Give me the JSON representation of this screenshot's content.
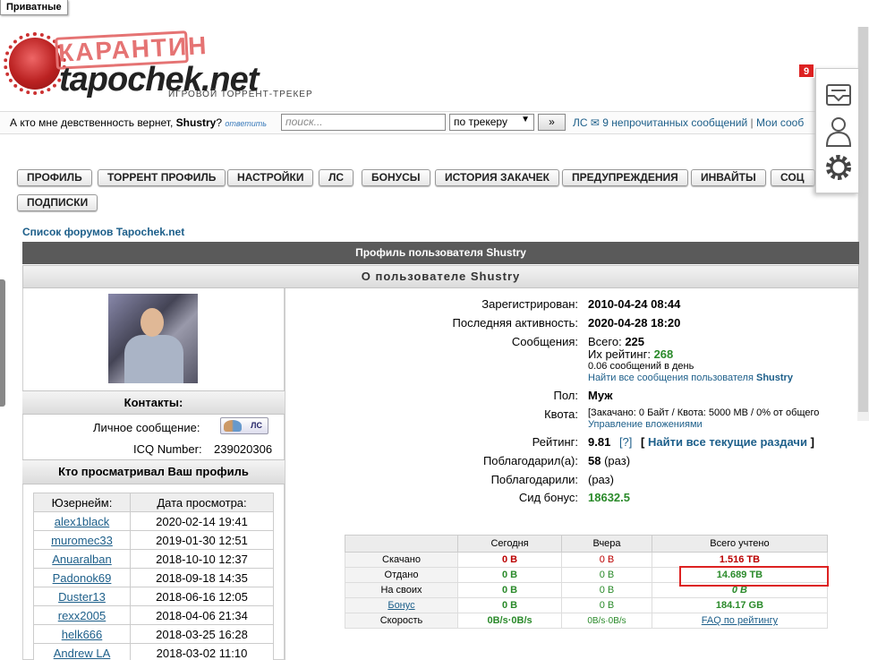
{
  "private_tab": "Приватные",
  "logo": {
    "stamp": "КАРАНТИН",
    "brand": "tapochek.net",
    "slogan": "ИГРОВОЙ ТОРРЕНТ-ТРЕКЕР"
  },
  "topbar": {
    "question_prefix": "А кто мне девственность вернет,",
    "question_user": "Shustry",
    "question_suffix": "?",
    "answer_link": "ответить",
    "search_placeholder": "поиск...",
    "tracker_select": "по трекеру",
    "go_button": "»",
    "pm_label": "ЛС",
    "unread_link": "9 непрочитанных сообщений",
    "separator": "|",
    "my_messages": "Мои сооб"
  },
  "side_panel": {
    "badge": "9",
    "icons": [
      "inbox-icon",
      "profile-icon",
      "settings-gear-icon"
    ]
  },
  "menu": [
    "ПРОФИЛЬ",
    "ТОРРЕНТ ПРОФИЛЬ",
    "НАСТРОЙКИ",
    "ЛС",
    "БОНУСЫ",
    "ИСТОРИЯ ЗАКАЧЕК",
    "ПРЕДУПРЕЖДЕНИЯ",
    "ИНВАЙТЫ",
    "СОЦ",
    "ПОДПИСКИ"
  ],
  "forum_link": "Список форумов Tapochek.net",
  "profile_header": "Профиль пользователя Shustry",
  "about_header": "О пользователе Shustry",
  "contacts": {
    "title": "Контакты:",
    "pm_label": "Личное сообщение:",
    "pm_button": "ЛС",
    "icq_label": "ICQ Number:",
    "icq_value": "239020306"
  },
  "viewers": {
    "title": "Кто просматривал Ваш профиль",
    "col_user": "Юзернейм:",
    "col_date": "Дата просмотра:",
    "rows": [
      {
        "user": "alex1black",
        "date": "2020-02-14 19:41"
      },
      {
        "user": "muromec33",
        "date": "2019-01-30 12:51"
      },
      {
        "user": "Anuaralban",
        "date": "2018-10-10 12:37"
      },
      {
        "user": "Padonok69",
        "date": "2018-09-18 14:35"
      },
      {
        "user": "Duster13",
        "date": "2018-06-16 12:05"
      },
      {
        "user": "rexx2005",
        "date": "2018-04-06 21:34"
      },
      {
        "user": "helk666",
        "date": "2018-03-25 16:28"
      },
      {
        "user": "Andrew LA",
        "date": "2018-03-02 11:10"
      }
    ]
  },
  "info": {
    "registered_label": "Зарегистрирован:",
    "registered": "2010-04-24 08:44",
    "last_active_label": "Последняя активность:",
    "last_active": "2020-04-28 18:20",
    "messages_label": "Сообщения:",
    "messages_total_label": "Всего:",
    "messages_total": "225",
    "rating_label_inner": "Их рейтинг:",
    "rating_inner": "268",
    "per_day": "0.06 сообщений в день",
    "find_posts": "Найти все сообщения пользователя",
    "find_posts_user": "Shustry",
    "gender_label": "Пол:",
    "gender": "Муж",
    "quota_label": "Квота:",
    "quota": "[Закачано: 0 Байт / Квота: 5000 MB / 0% от общего",
    "manage_attachments": "Управление вложениями",
    "rating_label": "Рейтинг:",
    "rating": "9.81",
    "rating_help": "[?]",
    "find_seeds": "Найти все текущие раздачи",
    "bracket_open": "[",
    "bracket_close": "]",
    "thanked_label": "Поблагодарил(а):",
    "thanked": "58",
    "times": "(раз)",
    "thanked_by_label": "Поблагодарили:",
    "thanked_by": "(раз)",
    "seed_bonus_label": "Сид бонус:",
    "seed_bonus": "18632.5"
  },
  "stats": {
    "cols": [
      "",
      "Сегодня",
      "Вчера",
      "Всего учтено"
    ],
    "rows": [
      {
        "label": "Скачано",
        "today": "0 B",
        "yesterday": "0 B",
        "total": "1.516 TB"
      },
      {
        "label": "Отдано",
        "today": "0 B",
        "yesterday": "0 B",
        "total": "14.689 TB"
      },
      {
        "label": "На своих",
        "today": "0 B",
        "yesterday": "0 B",
        "total": "0 B"
      },
      {
        "label": "Бонус",
        "today": "0 B",
        "yesterday": "0 B",
        "total": "184.17 GB"
      },
      {
        "label": "Скорость",
        "today": "0B/s·0B/s",
        "yesterday": "0B/s·0B/s",
        "total": "FAQ по рейтингу"
      }
    ]
  },
  "colors": {
    "accent": "#1d5f8a",
    "header_dark": "#5a5a5a",
    "green": "#2a8a2a",
    "red": "#b00000",
    "highlight": "#dd2222"
  }
}
